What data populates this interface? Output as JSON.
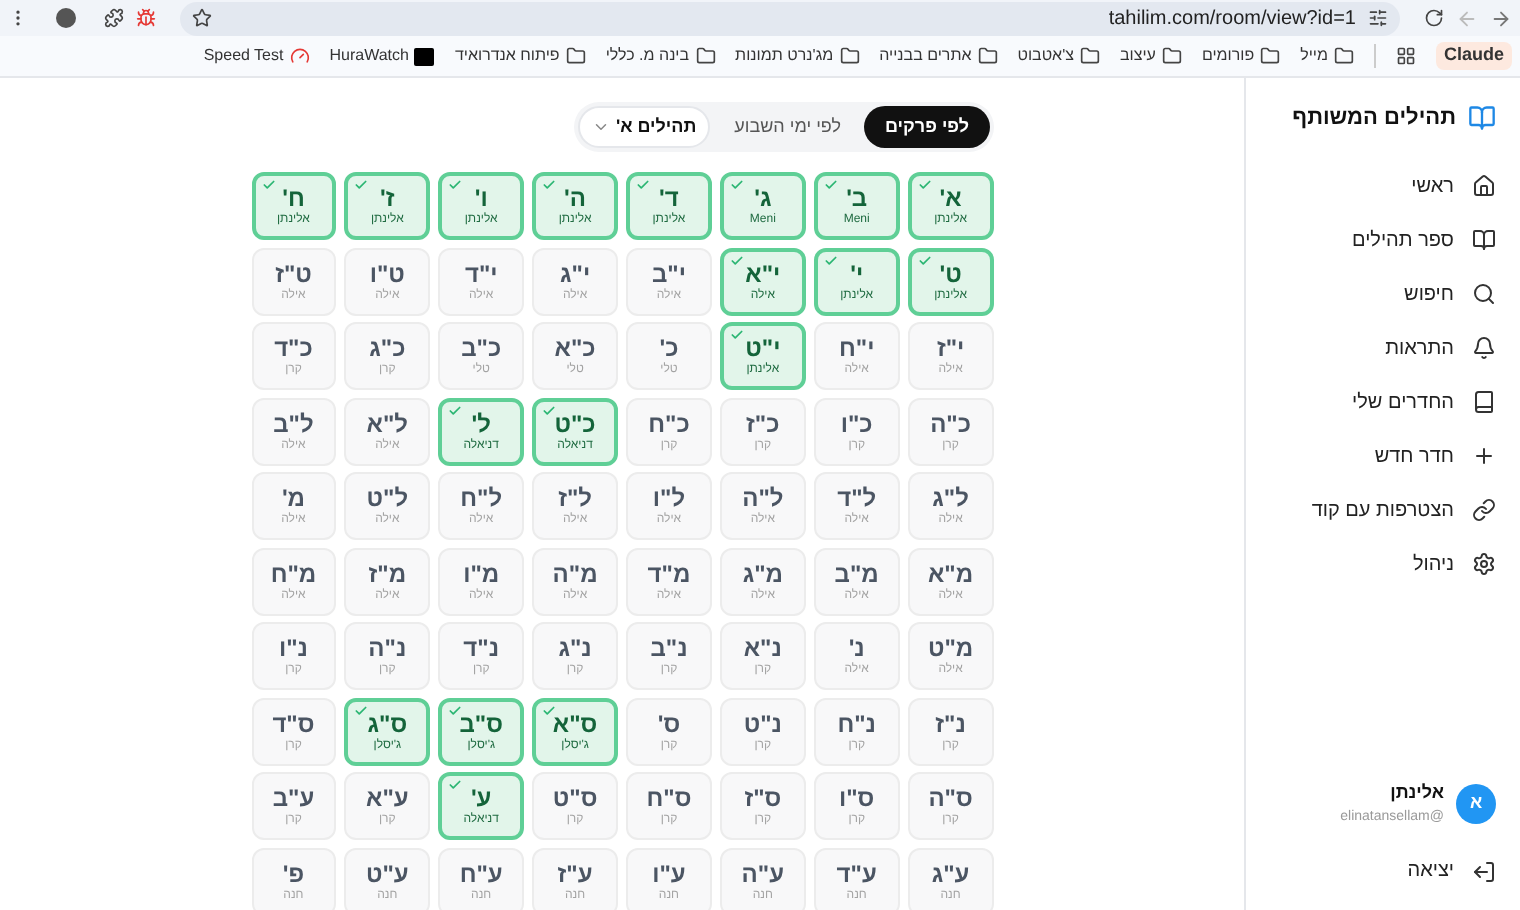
{
  "browser": {
    "url": "tahilim.com/room/view?id=1",
    "bookmarks": [
      {
        "label": "Claude",
        "kind": "chip"
      },
      {
        "label": "מייל",
        "kind": "folder"
      },
      {
        "label": "פורומים",
        "kind": "folder"
      },
      {
        "label": "עיצוב",
        "kind": "folder"
      },
      {
        "label": "צ'אטבוט",
        "kind": "folder"
      },
      {
        "label": "אתרים בבנייה",
        "kind": "folder"
      },
      {
        "label": "מג'נרט תמונות",
        "kind": "folder"
      },
      {
        "label": "בינה מ. כללי",
        "kind": "folder"
      },
      {
        "label": "פיתוח אנדרואיד",
        "kind": "folder"
      },
      {
        "label": "HuraWatch",
        "kind": "video"
      },
      {
        "label": "Speed Test",
        "kind": "speed"
      }
    ]
  },
  "sidebar": {
    "title": "תהילים המשותף",
    "items": [
      {
        "label": "ראשי",
        "kind": "home"
      },
      {
        "label": "ספר תהילים",
        "kind": "book-open"
      },
      {
        "label": "חיפוש",
        "kind": "search"
      },
      {
        "label": "התראות",
        "kind": "bell"
      },
      {
        "label": "החדרים שלי",
        "kind": "book"
      },
      {
        "label": "חדר חדש",
        "kind": "plus"
      },
      {
        "label": "הצטרפות עם קוד",
        "kind": "link"
      },
      {
        "label": "ניהול",
        "kind": "settings"
      }
    ],
    "user": {
      "initial": "א",
      "name": "אלינתן",
      "email": "@elinatansellam"
    },
    "logout": "יציאה"
  },
  "tabs": [
    {
      "label": "לפי פרקים",
      "selected": true
    },
    {
      "label": "לפי ימי השבוע",
      "selected": false
    }
  ],
  "book_select": {
    "value": "תהילים א'"
  },
  "chapters": [
    {
      "label": "א'",
      "reader": "אלינתן",
      "done": true
    },
    {
      "label": "ב'",
      "reader": "Meni",
      "done": true
    },
    {
      "label": "ג'",
      "reader": "Meni",
      "done": true
    },
    {
      "label": "ד'",
      "reader": "אלינתן",
      "done": true
    },
    {
      "label": "ה'",
      "reader": "אלינתן",
      "done": true
    },
    {
      "label": "ו'",
      "reader": "אלינתן",
      "done": true
    },
    {
      "label": "ז'",
      "reader": "אלינתן",
      "done": true
    },
    {
      "label": "ח'",
      "reader": "אלינתן",
      "done": true
    },
    {
      "label": "ט'",
      "reader": "אלינתן",
      "done": true
    },
    {
      "label": "י'",
      "reader": "אלינתן",
      "done": true
    },
    {
      "label": "י\"א",
      "reader": "אילה",
      "done": true
    },
    {
      "label": "י\"ב",
      "reader": "אילה",
      "done": false
    },
    {
      "label": "י\"ג",
      "reader": "אילה",
      "done": false
    },
    {
      "label": "י\"ד",
      "reader": "אילה",
      "done": false
    },
    {
      "label": "ט\"ו",
      "reader": "אילה",
      "done": false
    },
    {
      "label": "ט\"ז",
      "reader": "אילה",
      "done": false
    },
    {
      "label": "י\"ז",
      "reader": "אילה",
      "done": false
    },
    {
      "label": "י\"ח",
      "reader": "אילה",
      "done": false
    },
    {
      "label": "י\"ט",
      "reader": "אלינתן",
      "done": true
    },
    {
      "label": "כ'",
      "reader": "טלי",
      "done": false
    },
    {
      "label": "כ\"א",
      "reader": "טלי",
      "done": false
    },
    {
      "label": "כ\"ב",
      "reader": "טלי",
      "done": false
    },
    {
      "label": "כ\"ג",
      "reader": "קרן",
      "done": false
    },
    {
      "label": "כ\"ד",
      "reader": "קרן",
      "done": false
    },
    {
      "label": "כ\"ה",
      "reader": "קרן",
      "done": false
    },
    {
      "label": "כ\"ו",
      "reader": "קרן",
      "done": false
    },
    {
      "label": "כ\"ז",
      "reader": "קרן",
      "done": false
    },
    {
      "label": "כ\"ח",
      "reader": "קרן",
      "done": false
    },
    {
      "label": "כ\"ט",
      "reader": "דניאלה",
      "done": true
    },
    {
      "label": "ל'",
      "reader": "דניאלה",
      "done": true
    },
    {
      "label": "ל\"א",
      "reader": "אילה",
      "done": false
    },
    {
      "label": "ל\"ב",
      "reader": "אילה",
      "done": false
    },
    {
      "label": "ל\"ג",
      "reader": "אילה",
      "done": false
    },
    {
      "label": "ל\"ד",
      "reader": "אילה",
      "done": false
    },
    {
      "label": "ל\"ה",
      "reader": "אילה",
      "done": false
    },
    {
      "label": "ל\"ו",
      "reader": "אילה",
      "done": false
    },
    {
      "label": "ל\"ז",
      "reader": "אילה",
      "done": false
    },
    {
      "label": "ל\"ח",
      "reader": "אילה",
      "done": false
    },
    {
      "label": "ל\"ט",
      "reader": "אילה",
      "done": false
    },
    {
      "label": "מ'",
      "reader": "אילה",
      "done": false
    },
    {
      "label": "מ\"א",
      "reader": "אילה",
      "done": false
    },
    {
      "label": "מ\"ב",
      "reader": "אילה",
      "done": false
    },
    {
      "label": "מ\"ג",
      "reader": "אילה",
      "done": false
    },
    {
      "label": "מ\"ד",
      "reader": "אילה",
      "done": false
    },
    {
      "label": "מ\"ה",
      "reader": "אילה",
      "done": false
    },
    {
      "label": "מ\"ו",
      "reader": "אילה",
      "done": false
    },
    {
      "label": "מ\"ז",
      "reader": "אילה",
      "done": false
    },
    {
      "label": "מ\"ח",
      "reader": "אילה",
      "done": false
    },
    {
      "label": "מ\"ט",
      "reader": "אילה",
      "done": false
    },
    {
      "label": "נ'",
      "reader": "אילה",
      "done": false
    },
    {
      "label": "נ\"א",
      "reader": "קרן",
      "done": false
    },
    {
      "label": "נ\"ב",
      "reader": "קרן",
      "done": false
    },
    {
      "label": "נ\"ג",
      "reader": "קרן",
      "done": false
    },
    {
      "label": "נ\"ד",
      "reader": "קרן",
      "done": false
    },
    {
      "label": "נ\"ה",
      "reader": "קרן",
      "done": false
    },
    {
      "label": "נ\"ו",
      "reader": "קרן",
      "done": false
    },
    {
      "label": "נ\"ז",
      "reader": "קרן",
      "done": false
    },
    {
      "label": "נ\"ח",
      "reader": "קרן",
      "done": false
    },
    {
      "label": "נ\"ט",
      "reader": "קרן",
      "done": false
    },
    {
      "label": "ס'",
      "reader": "קרן",
      "done": false
    },
    {
      "label": "ס\"א",
      "reader": "ג'יסלן",
      "done": true
    },
    {
      "label": "ס\"ב",
      "reader": "ג'יסלן",
      "done": true
    },
    {
      "label": "ס\"ג",
      "reader": "ג'יסלן",
      "done": true
    },
    {
      "label": "ס\"ד",
      "reader": "קרן",
      "done": false
    },
    {
      "label": "ס\"ה",
      "reader": "קרן",
      "done": false
    },
    {
      "label": "ס\"ו",
      "reader": "קרן",
      "done": false
    },
    {
      "label": "ס\"ז",
      "reader": "קרן",
      "done": false
    },
    {
      "label": "ס\"ח",
      "reader": "קרן",
      "done": false
    },
    {
      "label": "ס\"ט",
      "reader": "קרן",
      "done": false
    },
    {
      "label": "ע'",
      "reader": "דניאלה",
      "done": true
    },
    {
      "label": "ע\"א",
      "reader": "קרן",
      "done": false
    },
    {
      "label": "ע\"ב",
      "reader": "קרן",
      "done": false
    },
    {
      "label": "ע\"ג",
      "reader": "חנה",
      "done": false
    },
    {
      "label": "ע\"ד",
      "reader": "חנה",
      "done": false
    },
    {
      "label": "ע\"ה",
      "reader": "חנה",
      "done": false
    },
    {
      "label": "ע\"ו",
      "reader": "חנה",
      "done": false
    },
    {
      "label": "ע\"ז",
      "reader": "חנה",
      "done": false
    },
    {
      "label": "ע\"ח",
      "reader": "חנה",
      "done": false
    },
    {
      "label": "ע\"ט",
      "reader": "חנה",
      "done": false
    },
    {
      "label": "פ'",
      "reader": "חנה",
      "done": false
    }
  ]
}
